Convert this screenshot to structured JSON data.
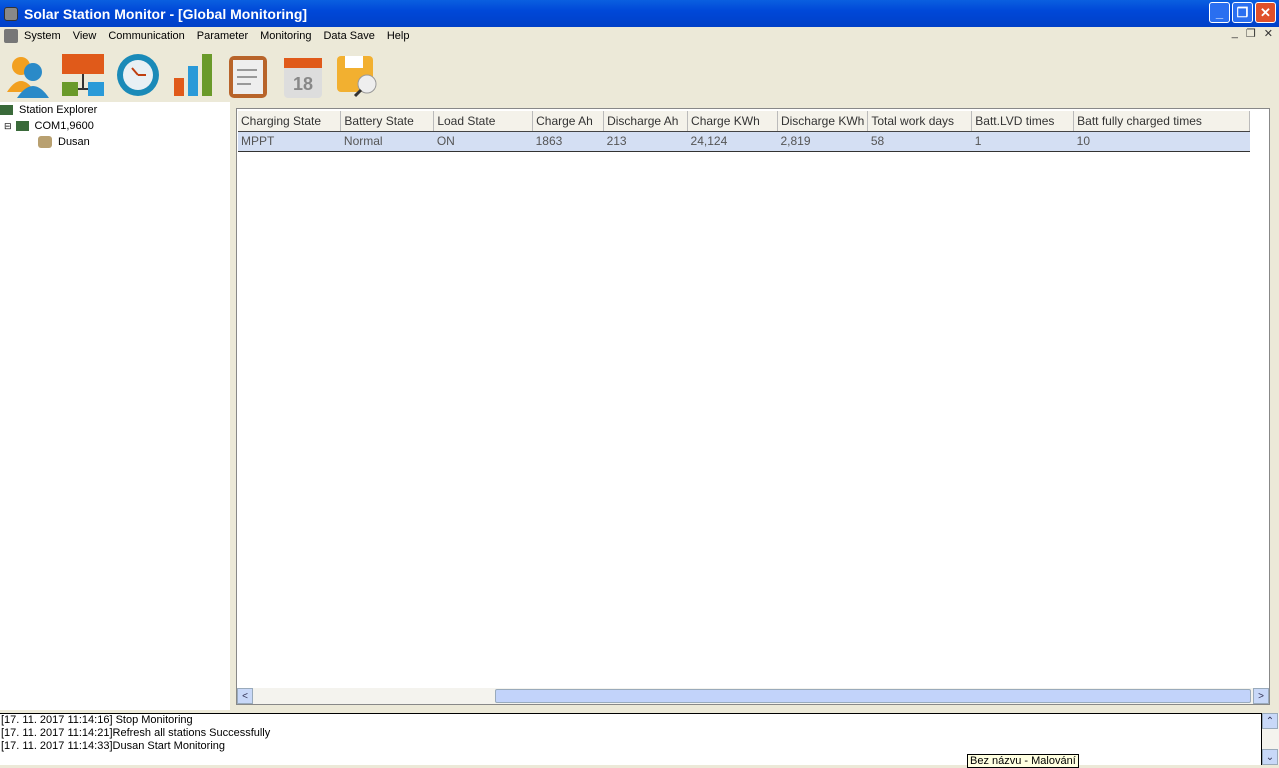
{
  "window": {
    "title": "Solar Station Monitor - [Global Monitoring]"
  },
  "menu": [
    "System",
    "View",
    "Communication",
    "Parameter",
    "Monitoring",
    "Data Save",
    "Help"
  ],
  "toolbar": [
    "users-icon",
    "network-icon",
    "clock-icon",
    "chart-icon",
    "clipboard-icon",
    "calendar-icon",
    "save-search-icon"
  ],
  "calendar_day": "18",
  "tree": {
    "root": "Station Explorer",
    "port": "COM1,9600",
    "station": "Dusan"
  },
  "table": {
    "columns": [
      "Charging State",
      "Battery State",
      "Load State",
      "Charge Ah",
      "Discharge Ah",
      "Charge KWh",
      "Discharge KWh",
      "Total work days",
      "Batt.LVD times",
      "Batt fully charged times"
    ],
    "rows": [
      [
        "MPPT",
        "Normal",
        "ON",
        "1863",
        "213",
        "24,124",
        "2,819",
        "58",
        "1",
        "10"
      ]
    ]
  },
  "log": [
    "[17. 11. 2017 11:14:16] Stop Monitoring",
    "[17. 11. 2017 11:14:21]Refresh all stations Successfully",
    "[17. 11. 2017 11:14:33]Dusan Start Monitoring"
  ],
  "tooltip": "Bez názvu - Malování"
}
